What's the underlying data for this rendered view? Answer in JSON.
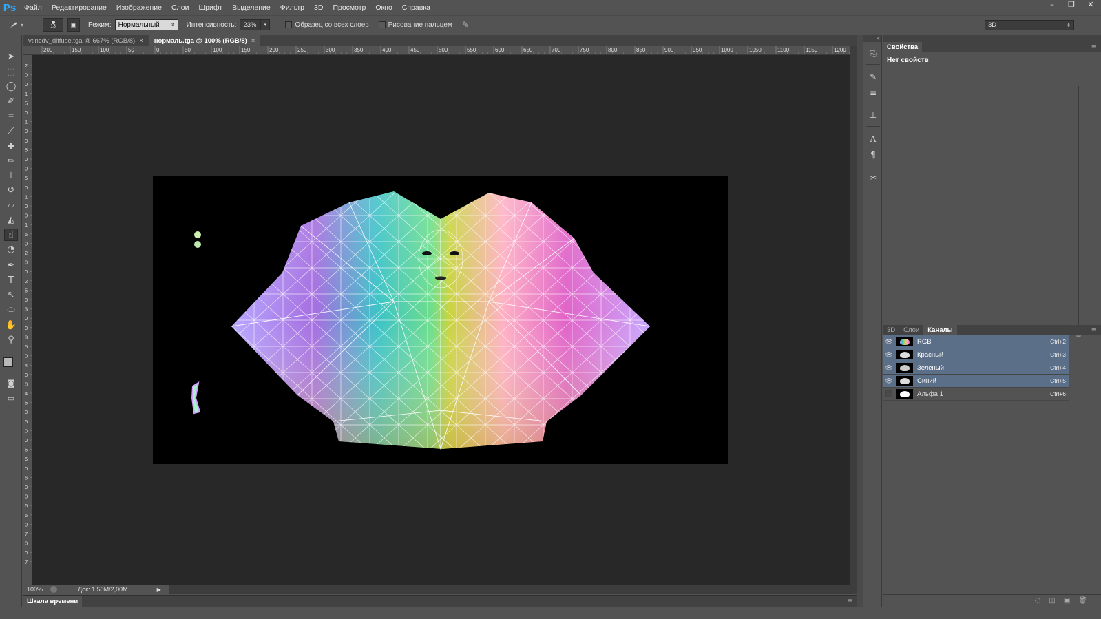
{
  "app": {
    "logo": "Ps",
    "menu": [
      "Файл",
      "Редактирование",
      "Изображение",
      "Слои",
      "Шрифт",
      "Выделение",
      "Фильтр",
      "3D",
      "Просмотр",
      "Окно",
      "Справка"
    ],
    "window_controls": [
      "–",
      "❐",
      "✕"
    ]
  },
  "options": {
    "brush_size": "13",
    "mode_label": "Режим:",
    "mode_value": "Нормальный",
    "strength_label": "Интенсивность:",
    "strength_value": "23%",
    "sample_all_layers": "Образец со всех слоев",
    "finger_painting": "Рисование пальцем",
    "workspace": "3D"
  },
  "tabs": [
    {
      "label": "vtlncdv_diffuse.tga @ 667% (RGB/8)",
      "close": "×"
    },
    {
      "label": "нормаль.tga @ 100% (RGB/8)",
      "close": "×"
    }
  ],
  "ruler_top": [
    "200",
    "150",
    "100",
    "50",
    "0",
    "50",
    "100",
    "150",
    "200",
    "250",
    "300",
    "350",
    "400",
    "450",
    "500",
    "550",
    "600",
    "650",
    "700",
    "750",
    "800",
    "850",
    "900",
    "950",
    "1000",
    "1050",
    "1100",
    "1150",
    "1200"
  ],
  "ruler_left": [
    "2",
    "0",
    "0",
    "1",
    "5",
    "0",
    "1",
    "0",
    "0",
    "5",
    "0",
    "0",
    "5",
    "0",
    "1",
    "0",
    "0",
    "1",
    "5",
    "0",
    "2",
    "0",
    "0",
    "2",
    "5",
    "0",
    "3",
    "0",
    "0",
    "3",
    "5",
    "0",
    "4",
    "0",
    "0",
    "4",
    "5",
    "0",
    "5",
    "0",
    "0",
    "5",
    "5",
    "0",
    "6",
    "0",
    "0",
    "6",
    "5",
    "0",
    "7",
    "0",
    "0",
    "7"
  ],
  "status": {
    "zoom": "100%",
    "doc": "Док: 1,50M/2,00M",
    "arrow": "▶"
  },
  "timeline": {
    "title": "Шкала времени",
    "menu_icon": "≡"
  },
  "properties": {
    "tab": "Свойства",
    "empty": "Нет свойств",
    "menu_icon": "≡"
  },
  "channels_panel": {
    "tabs": [
      "3D",
      "Слои",
      "Каналы"
    ],
    "menu_icon": "≡",
    "rows": [
      {
        "name": "RGB",
        "shortcut": "Ctrl+2",
        "visible": true
      },
      {
        "name": "Красный",
        "shortcut": "Ctrl+3",
        "visible": true
      },
      {
        "name": "Зеленый",
        "shortcut": "Ctrl+4",
        "visible": true
      },
      {
        "name": "Синий",
        "shortcut": "Ctrl+5",
        "visible": true
      },
      {
        "name": "Альфа 1",
        "shortcut": "Ctrl+6",
        "visible": false
      }
    ]
  },
  "colors": {
    "ui_bg": "#535353",
    "canvas_bg": "#282828",
    "selection": "#5b6f88",
    "accent": "#31a8ff"
  }
}
